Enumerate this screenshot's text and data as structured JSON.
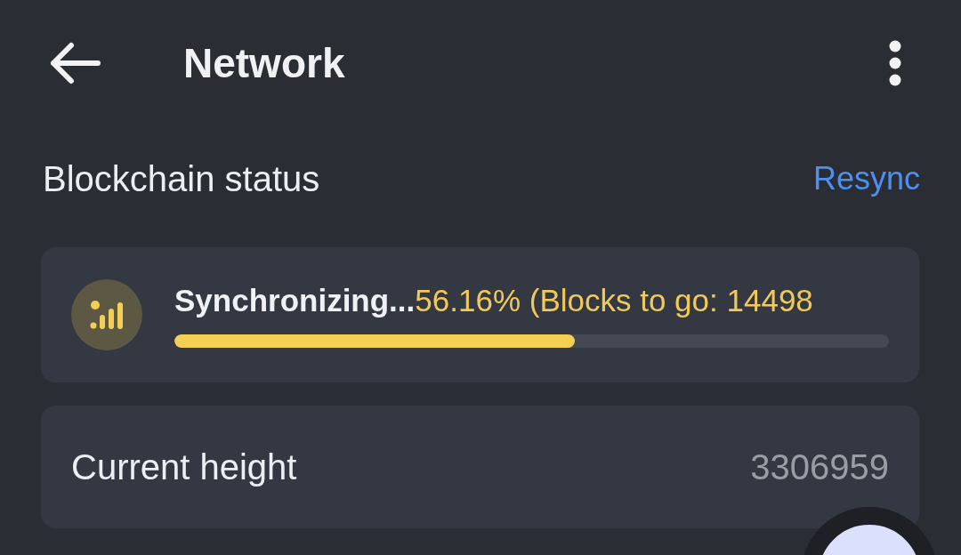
{
  "header": {
    "title": "Network"
  },
  "section": {
    "title": "Blockchain status",
    "action": "Resync"
  },
  "sync": {
    "status": "Synchronizing...",
    "progress": "56.16% (Blocks to go: 14498",
    "level": 0.561
  },
  "height_row": {
    "label": "Current height",
    "value": "3306959"
  }
}
